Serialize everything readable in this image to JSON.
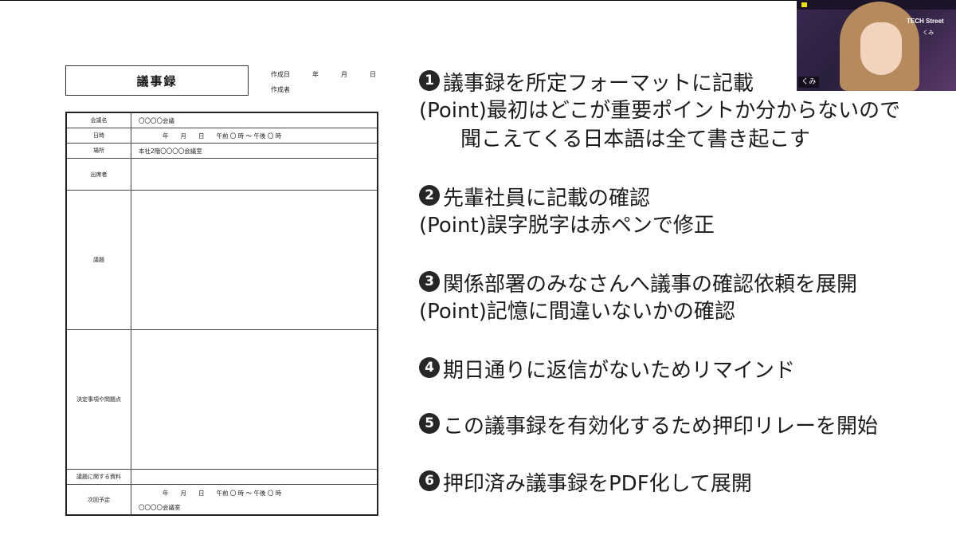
{
  "form": {
    "title": "議事録",
    "meta": {
      "created_date_label": "作成日",
      "year": "年",
      "month": "月",
      "day": "日",
      "author_label": "作成者"
    },
    "rows": {
      "meeting_name": {
        "label": "会議名",
        "value": "〇〇〇〇会議"
      },
      "datetime": {
        "label": "日時",
        "value": "年　　月　　日　　午前 〇 時 〜 午後 〇 時"
      },
      "place": {
        "label": "場所",
        "value": "本社2階〇〇〇〇会議室"
      },
      "attendees": {
        "label": "出席者"
      },
      "agenda": {
        "label": "議題"
      },
      "decisions": {
        "label": "決定事項や問題点"
      },
      "materials": {
        "label": "議題に関する資料"
      },
      "next": {
        "label": "次回予定",
        "value_line1": "年　　月　　日　　午前 〇 時 〜 午後 〇 時",
        "value_line2": "〇〇〇〇会議室"
      }
    }
  },
  "steps": [
    {
      "num": "1",
      "text": "議事録を所定フォーマットに記載"
    },
    {
      "num": "2",
      "text": "先輩社員に記載の確認"
    },
    {
      "num": "3",
      "text": "関係部署のみなさんへ議事の確認依頼を展開"
    },
    {
      "num": "4",
      "text": "期日通りに返信がないためリマインド"
    },
    {
      "num": "5",
      "text": "この議事録を有効化するため押印リレーを開始"
    },
    {
      "num": "6",
      "text": "押印済み議事録をPDF化して展開"
    }
  ],
  "points": {
    "p1_line1": "(Point)最初はどこが重要ポイントか分からないので",
    "p1_line2": "聞こえてくる日本語は全て書き起こす",
    "p2": "(Point)誤字脱字は赤ペンで修正",
    "p3": "(Point)記憶に間違いないかの確認"
  },
  "webcam": {
    "brand": "TECH Street",
    "brand_sub": "くみ",
    "name_tag": "くみ"
  }
}
